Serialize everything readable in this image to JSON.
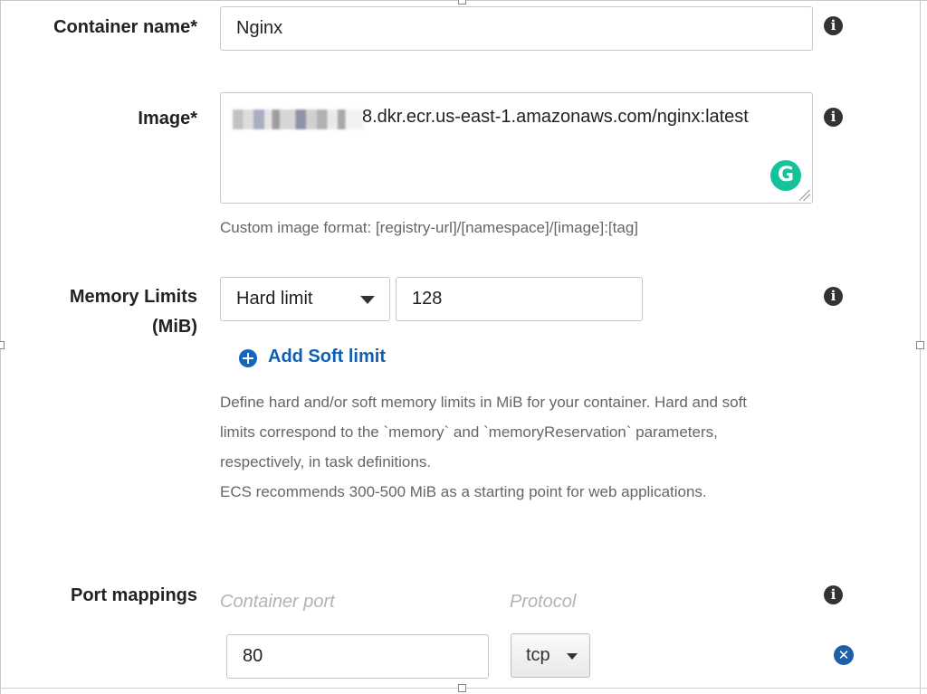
{
  "container_name": {
    "label": "Container name*",
    "value": "Nginx"
  },
  "image": {
    "label": "Image*",
    "value_visible": "8.dkr.ecr.us-east-1.amazonaws.com/nginx:latest",
    "help": "Custom image format: [registry-url]/[namespace]/[image]:[tag]",
    "grammarly_icon": "G"
  },
  "memory": {
    "label_line1": "Memory Limits",
    "label_line2": "(MiB)",
    "limit_type": "Hard limit",
    "limit_value": "128",
    "add_soft_limit": "Add Soft limit",
    "help_lines": [
      "Define hard and/or soft memory limits in MiB for your container. Hard and soft",
      "limits correspond to the `memory` and `memoryReservation` parameters,",
      "respectively, in task definitions.",
      "ECS recommends 300-500 MiB as a starting point for web applications."
    ]
  },
  "port_mappings": {
    "label": "Port mappings",
    "container_port_header": "Container port",
    "protocol_header": "Protocol",
    "rows": [
      {
        "container_port": "80",
        "protocol": "tcp"
      }
    ]
  },
  "icons": {
    "info": "info-icon",
    "add": "plus-circle-icon",
    "remove": "remove-circle-icon",
    "grammarly": "grammarly-icon",
    "caret": "caret-down-icon"
  },
  "colors": {
    "link": "#0d5fb5",
    "grammarly": "#15c39a",
    "info_icon": "#333333",
    "placeholder": "#b3b3b3"
  }
}
